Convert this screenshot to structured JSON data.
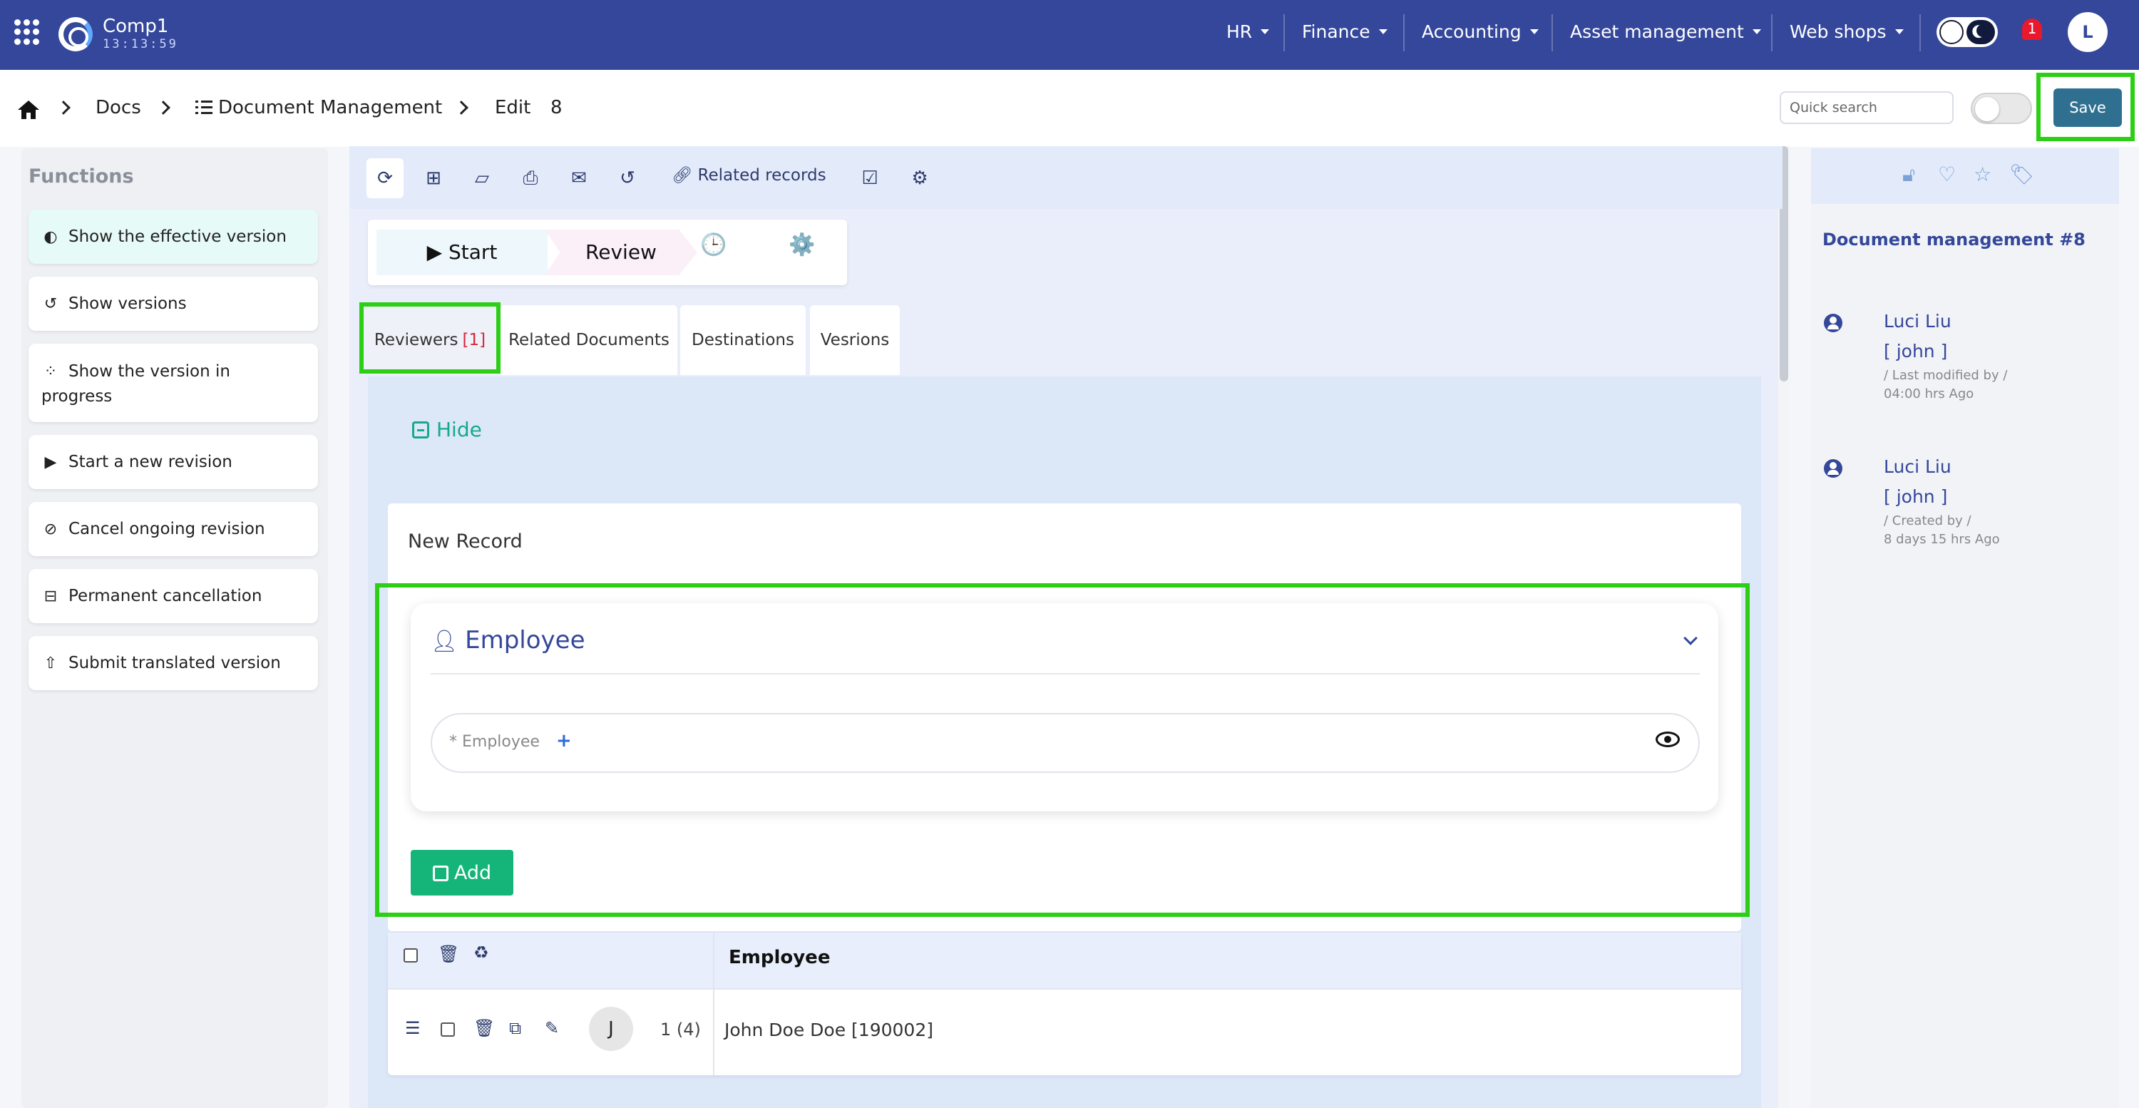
{
  "topbar": {
    "company": "Comp1",
    "clock": "13:13:59",
    "menus": [
      "HR",
      "Finance",
      "Accounting",
      "Asset management",
      "Web shops"
    ],
    "notifications": "1",
    "avatar_initial": "L"
  },
  "breadcrumb": {
    "items": [
      "Docs",
      "Document Management",
      "Edit"
    ],
    "record_id": "8"
  },
  "header_actions": {
    "quick_search_placeholder": "Quick search",
    "save_label": "Save"
  },
  "functions": {
    "title": "Functions",
    "items": [
      {
        "label": "Show the effective version",
        "icon": "shield-half-icon"
      },
      {
        "label": "Show versions",
        "icon": "history-icon"
      },
      {
        "label": "Show the version in progress",
        "icon": "spinner-icon"
      },
      {
        "label": "Start a new revision",
        "icon": "play-icon"
      },
      {
        "label": "Cancel ongoing revision",
        "icon": "ban-icon"
      },
      {
        "label": "Permanent cancellation",
        "icon": "minus-square-icon"
      },
      {
        "label": "Submit translated version",
        "icon": "upload-icon"
      }
    ]
  },
  "toolbar": {
    "related_records": "Related records"
  },
  "workflow": {
    "start": "▶ Start",
    "review": "Review",
    "clock_icon": "🕒",
    "gear_icon": "⚙️"
  },
  "tabs": [
    {
      "label": "Reviewers",
      "badge": "[1]"
    },
    {
      "label": "Related Documents"
    },
    {
      "label": "Destinations"
    },
    {
      "label": "Vesrions"
    }
  ],
  "reviewers": {
    "hide_label": "Hide",
    "new_record_title": "New Record",
    "section_title": "Employee",
    "employee_field_label": "* Employee",
    "employee_field_plus": "+",
    "add_label": "Add"
  },
  "grid": {
    "column_header": "Employee",
    "rows": [
      {
        "avatar": "J",
        "index": "1 (4)",
        "employee": "John Doe Doe [190002]"
      }
    ]
  },
  "right_panel": {
    "title": "Document management #8",
    "entries": [
      {
        "name": "Luci Liu",
        "user": "[ john ]",
        "action": "/ Last modified by /",
        "time": "04:00 hrs Ago"
      },
      {
        "name": "Luci Liu",
        "user": "[ john ]",
        "action": "/ Created by /",
        "time": "8 days 15 hrs Ago"
      }
    ]
  },
  "colors": {
    "navbar": "#34479a",
    "save_button": "#2f7090",
    "add_button": "#15b57a",
    "highlight": "#2ccf16",
    "badge_red": "#d6263b"
  }
}
